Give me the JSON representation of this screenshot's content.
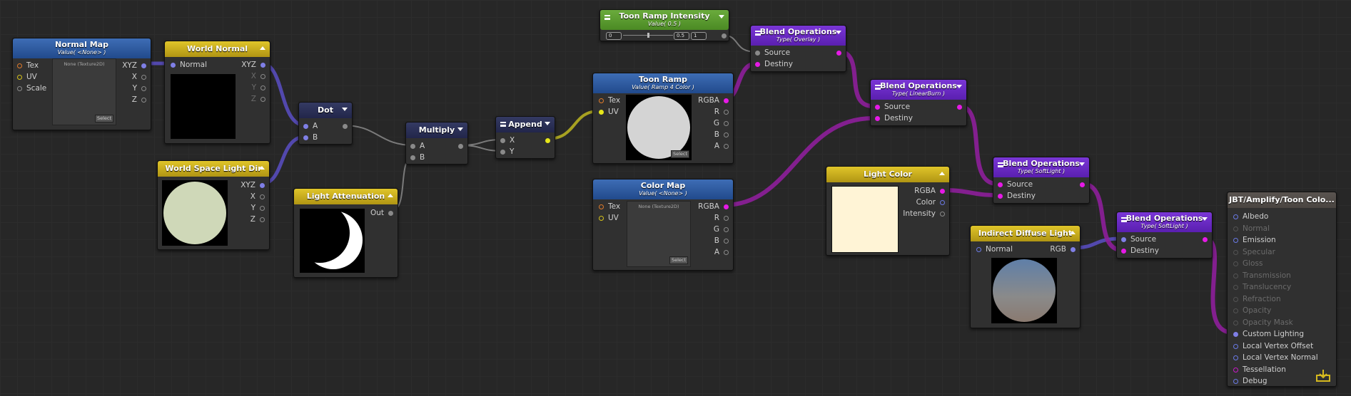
{
  "colors": {
    "wire_purple": "#6b4fd6",
    "wire_magenta": "#9b1fa8",
    "wire_yellow": "#c8c020",
    "wire_gray": "#7a7a7a",
    "accent_blue": "#2e5ea8",
    "accent_yellow": "#d4b81e",
    "accent_purple": "#6a2ac6",
    "accent_green": "#5d9b30"
  },
  "nodes": {
    "normal_map": {
      "title": "Normal Map",
      "subtitle": "Value( <None> )",
      "inputs": [
        "Tex",
        "UV",
        "Scale"
      ],
      "outputs": [
        "XYZ",
        "X",
        "Y",
        "Z"
      ],
      "texture_label": "None (Texture2D)",
      "select": "Select"
    },
    "world_normal": {
      "title": "World Normal",
      "inputs": [
        "Normal"
      ],
      "outputs": [
        "XYZ",
        "X",
        "Y",
        "Z"
      ]
    },
    "world_space_light_dir": {
      "title": "World Space Light Dir",
      "outputs": [
        "XYZ",
        "X",
        "Y",
        "Z"
      ]
    },
    "light_attenuation": {
      "title": "Light Attenuation",
      "outputs": [
        "Out"
      ]
    },
    "dot": {
      "title": "Dot",
      "inputs": [
        "A",
        "B"
      ]
    },
    "multiply": {
      "title": "Multiply",
      "inputs": [
        "A",
        "B"
      ]
    },
    "append": {
      "title": "Append",
      "inputs": [
        "X",
        "Y"
      ]
    },
    "toon_ramp_intensity": {
      "title": "Toon Ramp Intensity",
      "subtitle": "Value( 0.5 )",
      "min": "0",
      "value": "0.5",
      "max": "1",
      "slider_fraction": 0.5
    },
    "toon_ramp": {
      "title": "Toon Ramp",
      "subtitle": "Value( Ramp 4 Color )",
      "inputs": [
        "Tex",
        "UV"
      ],
      "outputs": [
        "RGBA",
        "R",
        "G",
        "B",
        "A"
      ],
      "select": "Select"
    },
    "color_map": {
      "title": "Color Map",
      "subtitle": "Value( <None> )",
      "inputs": [
        "Tex",
        "UV"
      ],
      "outputs": [
        "RGBA",
        "R",
        "G",
        "B",
        "A"
      ],
      "texture_label": "None (Texture2D)",
      "select": "Select"
    },
    "blend_overlay": {
      "title": "Blend Operations",
      "subtitle": "Type( Overlay )",
      "inputs": [
        "Source",
        "Destiny"
      ]
    },
    "blend_linearburn": {
      "title": "Blend Operations",
      "subtitle": "Type( LinearBurn )",
      "inputs": [
        "Source",
        "Destiny"
      ]
    },
    "blend_softlight_1": {
      "title": "Blend Operations",
      "subtitle": "Type( SoftLight )",
      "inputs": [
        "Source",
        "Destiny"
      ]
    },
    "blend_softlight_2": {
      "title": "Blend Operations",
      "subtitle": "Type( SoftLight )",
      "inputs": [
        "Source",
        "Destiny"
      ]
    },
    "light_color": {
      "title": "Light Color",
      "outputs": [
        "RGBA",
        "Color",
        "Intensity"
      ],
      "swatch": "#fff4d6"
    },
    "indirect_diffuse": {
      "title": "Indirect Diffuse Light",
      "inputs": [
        "Normal"
      ],
      "outputs": [
        "RGB"
      ]
    },
    "output": {
      "title": "JBT/Amplify/Toon Colo...",
      "inputs": [
        {
          "label": "Albedo",
          "active": true
        },
        {
          "label": "Normal",
          "active": false
        },
        {
          "label": "Emission",
          "active": true
        },
        {
          "label": "Specular",
          "active": false
        },
        {
          "label": "Gloss",
          "active": false
        },
        {
          "label": "Transmission",
          "active": false
        },
        {
          "label": "Translucency",
          "active": false
        },
        {
          "label": "Refraction",
          "active": false
        },
        {
          "label": "Opacity",
          "active": false
        },
        {
          "label": "Opacity Mask",
          "active": false
        },
        {
          "label": "Custom Lighting",
          "active": true
        },
        {
          "label": "Local Vertex Offset",
          "active": true
        },
        {
          "label": "Local Vertex Normal",
          "active": true
        },
        {
          "label": "Tessellation",
          "active": true
        },
        {
          "label": "Debug",
          "active": true
        }
      ]
    }
  }
}
